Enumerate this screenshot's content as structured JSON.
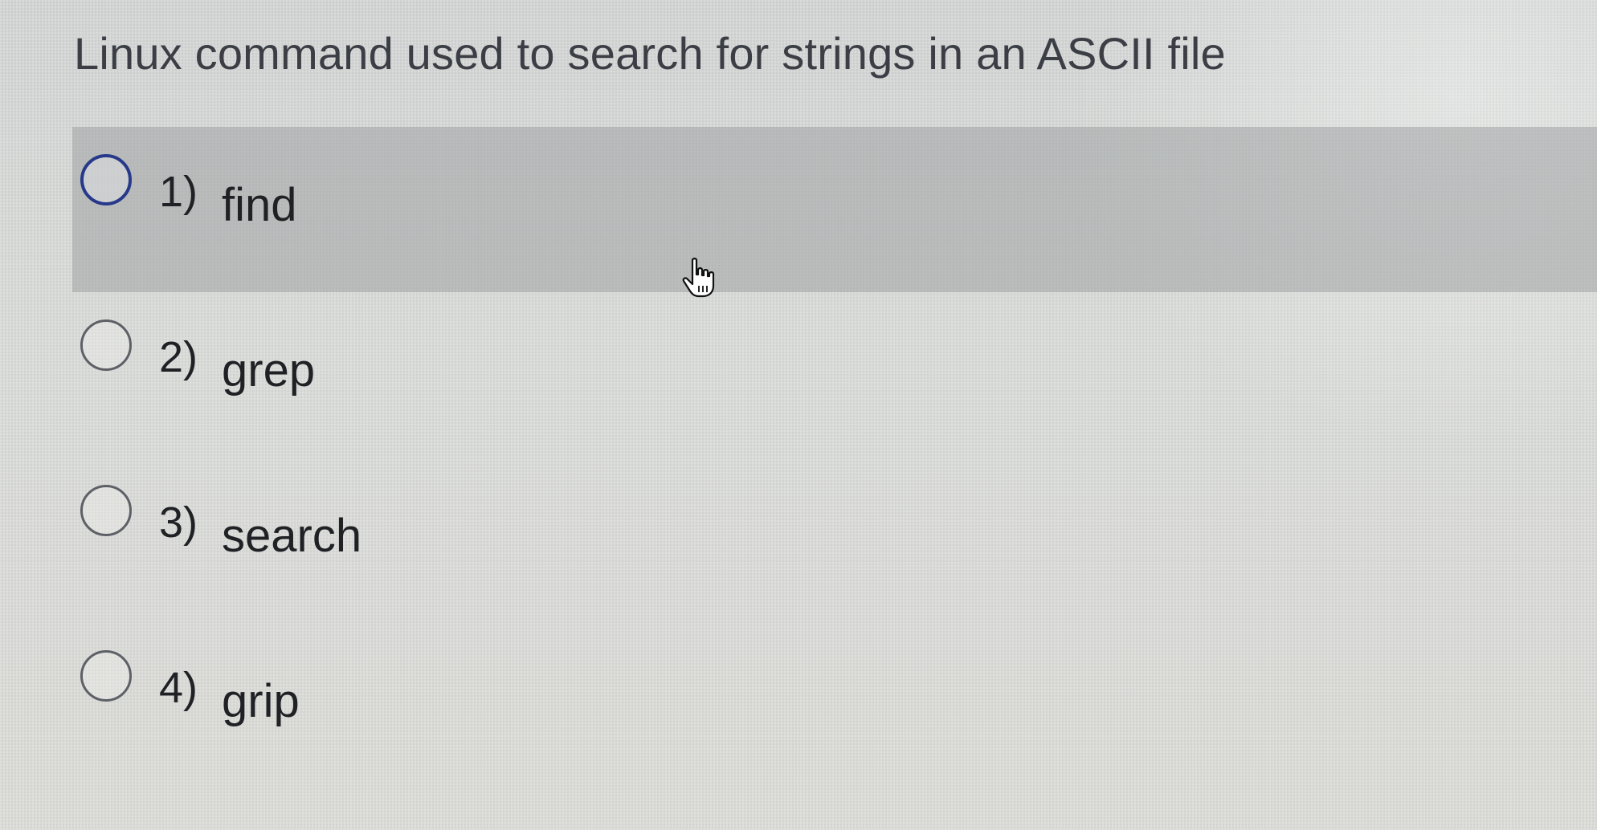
{
  "question": {
    "text": "Linux command used to search for strings in an ASCII file"
  },
  "options": [
    {
      "number": "1)",
      "label": "find",
      "hovered": true
    },
    {
      "number": "2)",
      "label": "grep",
      "hovered": false
    },
    {
      "number": "3)",
      "label": "search",
      "hovered": false
    },
    {
      "number": "4)",
      "label": "grip",
      "hovered": false
    }
  ],
  "colors": {
    "hover_row": "#a0a2a4",
    "radio_hover_border": "#27398a",
    "radio_border": "#5d6066",
    "text": "#1f2125"
  },
  "icons": {
    "cursor": "hand-pointer-cursor-icon"
  }
}
